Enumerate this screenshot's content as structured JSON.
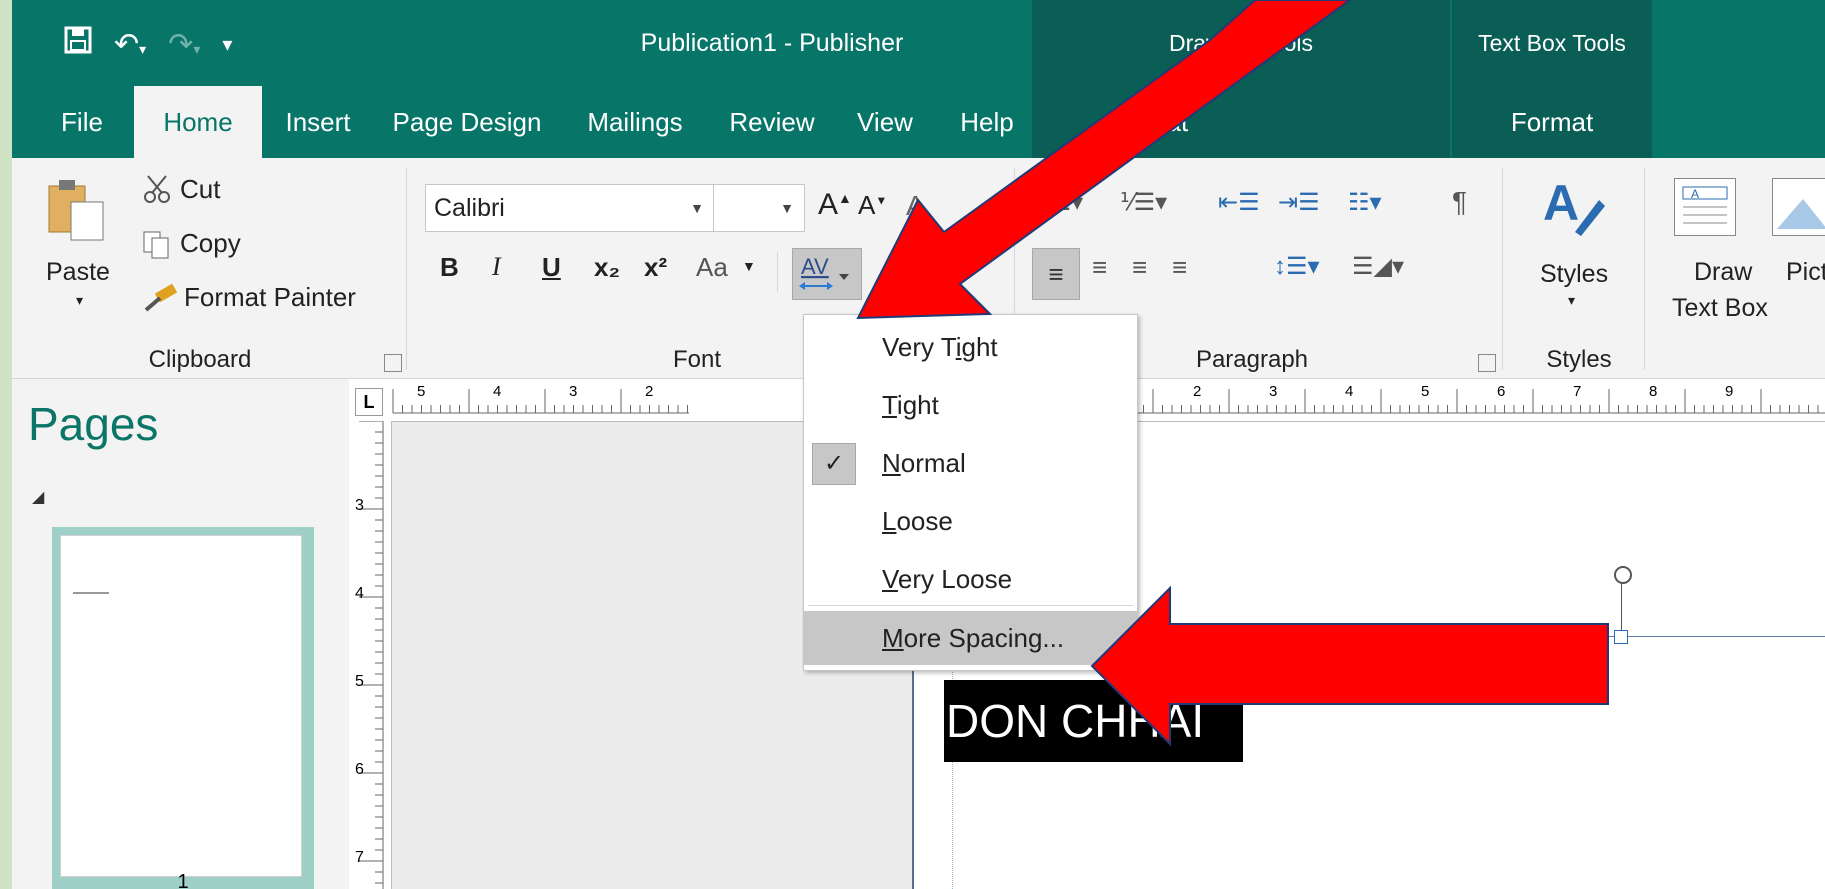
{
  "window": {
    "title": "Publication1  -  Publisher",
    "quick_access": [
      "save-icon",
      "undo-icon",
      "redo-icon",
      "customize-icon"
    ]
  },
  "contextual_tabs": {
    "drawing_tools": "Drawing Tools",
    "text_box_tools": "Text Box Tools"
  },
  "tabs": [
    "File",
    "Home",
    "Insert",
    "Page Design",
    "Mailings",
    "Review",
    "View",
    "Help",
    "Format",
    "Format"
  ],
  "clipboard": {
    "paste": "Paste",
    "cut": "Cut",
    "copy": "Copy",
    "format_painter": "Format Painter",
    "group_label": "Clipboard"
  },
  "font": {
    "font_name": "Calibri",
    "font_size": "",
    "group_label": "Font",
    "buttons": [
      "B",
      "I",
      "U",
      "x₂",
      "x²",
      "Aa"
    ]
  },
  "paragraph": {
    "group_label": "Paragraph"
  },
  "styles": {
    "label": "Styles",
    "group_label": "Styles"
  },
  "objects": {
    "draw_text_box_1": "Draw",
    "draw_text_box_2": "Text Box",
    "picture": "Pict"
  },
  "pages_panel": {
    "title": "Pages",
    "page_number": "1"
  },
  "character_spacing_menu": {
    "items": [
      {
        "label": "Very Tight",
        "checked": false
      },
      {
        "label": "Tight",
        "checked": false
      },
      {
        "label": "Normal",
        "checked": true
      },
      {
        "label": "Loose",
        "checked": false
      },
      {
        "label": "Very Loose",
        "checked": false
      }
    ],
    "more": "More Spacing..."
  },
  "canvas": {
    "textbox_text": "DON CHHAI"
  },
  "ruler": {
    "h_left": [
      "5",
      "4",
      "3",
      "2"
    ],
    "h_right": [
      "2",
      "3",
      "4",
      "5",
      "6",
      "7",
      "8",
      "9"
    ],
    "v": [
      "3",
      "4",
      "5",
      "6",
      "7"
    ],
    "corner": "L"
  },
  "colors": {
    "accent": "#077568",
    "arrow": "#ff0000",
    "contextual": "#0b5e55"
  }
}
